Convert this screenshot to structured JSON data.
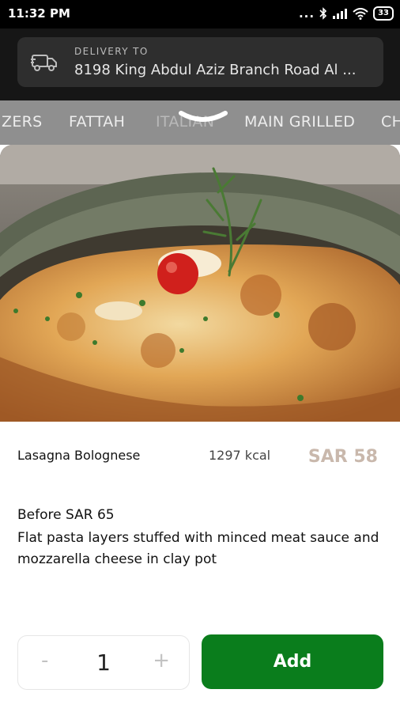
{
  "status_bar": {
    "time": "11:32 PM",
    "signal_dots": "...",
    "battery": "33"
  },
  "header": {
    "delivery_label": "DELIVERY TO",
    "delivery_address": "8198 King Abdul Aziz Branch Road Al ...",
    "truck_icon": "delivery-truck-icon"
  },
  "categories": [
    {
      "label": "ZERS"
    },
    {
      "label": "FATTAH"
    },
    {
      "label": "ITALIAN"
    },
    {
      "label": "MAIN GRILLED"
    },
    {
      "label": "CH"
    }
  ],
  "item": {
    "name": "Lasagna Bolognese",
    "calories": "1297 kcal",
    "price": "SAR 58",
    "before_price": "Before SAR 65",
    "description": "Flat pasta layers stuffed with minced meat sauce and mozzarella cheese in clay pot"
  },
  "quantity": {
    "minus": "-",
    "value": "1",
    "plus": "+"
  },
  "add_button": {
    "label": "Add",
    "color": "#0a7d1c"
  },
  "colors": {
    "header_bg": "#161616",
    "category_bar": "#8f8f8f",
    "price": "#c9b8ac"
  }
}
